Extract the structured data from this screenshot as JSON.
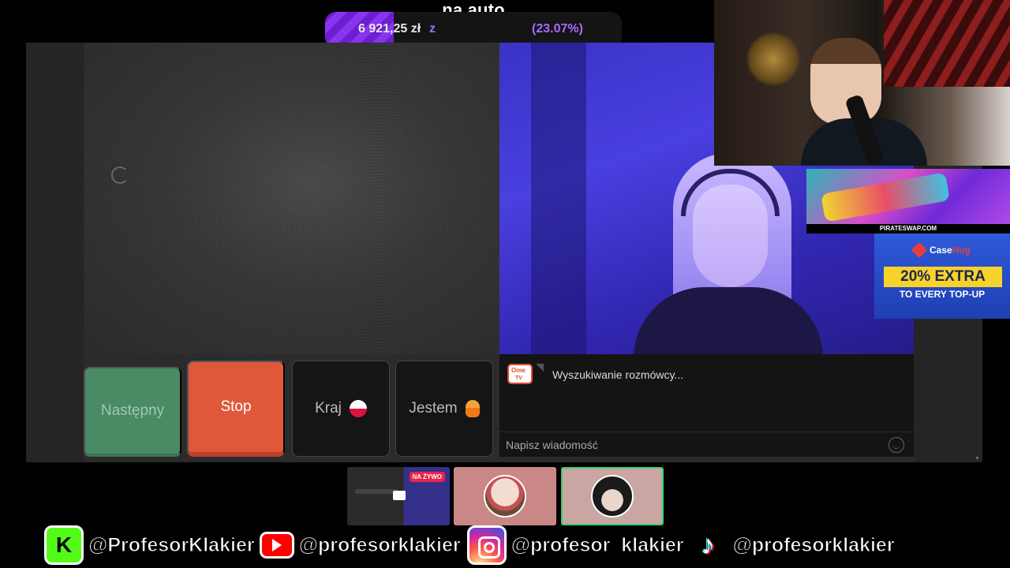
{
  "goal": {
    "title": "na auto",
    "amount": "6 921,25 zł",
    "suffix": "z",
    "percent_label": "(23.07%)",
    "progress_fraction": 0.2307,
    "fill_color": "#7a2ae0"
  },
  "ometv": {
    "buttons": {
      "next": "Następny",
      "stop": "Stop",
      "country": "Kraj",
      "gender": "Jestem"
    },
    "chat": {
      "logo_top": "Ome",
      "logo_bottom": "TV",
      "status": "Wyszukiwanie rozmówcy...",
      "input_placeholder": "Napisz wiadomość"
    }
  },
  "ads": {
    "pirateswap": {
      "caption": "PIRATESWAP.COM"
    },
    "casehug": {
      "brand_a": "Case",
      "brand_b": "Hug",
      "offer": "20% EXTRA",
      "subline": "TO EVERY TOP-UP"
    }
  },
  "scenes": {
    "live_badge": "NA ŻYWO"
  },
  "socials": [
    {
      "platform": "kick",
      "icon": "kick-icon",
      "glyph": "K",
      "handle": "@ProfesorKlakier"
    },
    {
      "platform": "youtube",
      "icon": "youtube-icon",
      "handle": "@profesorklakier"
    },
    {
      "platform": "instagram",
      "icon": "instagram-icon",
      "handle": "@profesor_klakier"
    },
    {
      "platform": "tiktok",
      "icon": "tiktok-icon",
      "glyph": "♪",
      "handle": "@profesorklakier"
    }
  ],
  "colors": {
    "stop_button": "#e0583a",
    "next_button": "#4a8a64",
    "active_scene_border": "#37d46a",
    "kick_green": "#53fc18",
    "goal_accent": "#a86bff"
  }
}
